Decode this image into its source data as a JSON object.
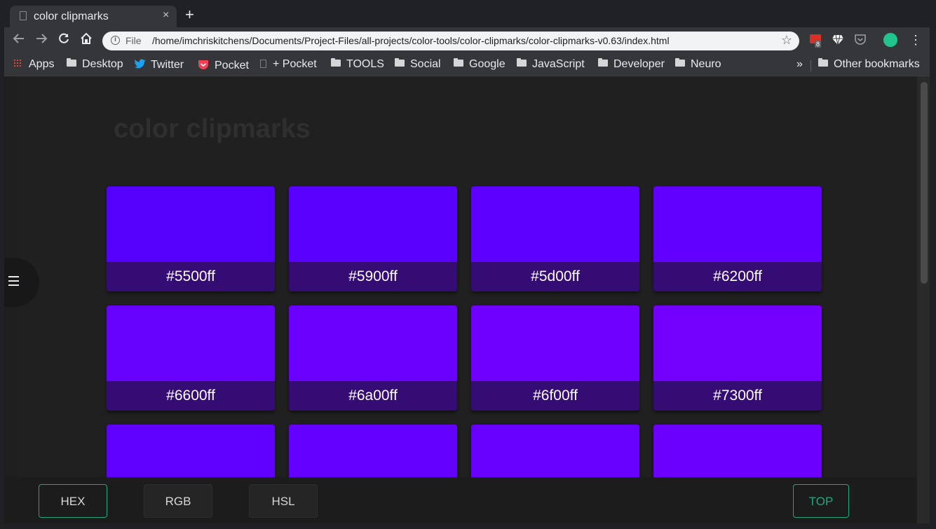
{
  "browser": {
    "tab": {
      "title": "color clipmarks",
      "close": "×"
    },
    "new_tab": "+",
    "address": {
      "scheme": "File",
      "url": "/home/imchriskitchens/Documents/Project-Files/all-projects/color-tools/color-clipmarks/color-clipmarks-v0.63/index.html"
    },
    "extension_badge": "8",
    "bookmarks": [
      {
        "label": "Apps",
        "icon": "apps-grid-icon"
      },
      {
        "label": "Desktop",
        "icon": "folder-icon"
      },
      {
        "label": "Twitter",
        "icon": "twitter-icon"
      },
      {
        "label": "Pocket",
        "icon": "pocket-icon"
      },
      {
        "label": "+ Pocket",
        "icon": "page-icon"
      },
      {
        "label": "TOOLS",
        "icon": "folder-icon"
      },
      {
        "label": "Social",
        "icon": "folder-icon"
      },
      {
        "label": "Google",
        "icon": "folder-icon"
      },
      {
        "label": "JavaScript",
        "icon": "folder-icon"
      },
      {
        "label": "Developer",
        "icon": "folder-icon"
      },
      {
        "label": "Neuro",
        "icon": "folder-icon"
      }
    ],
    "overflow": "»",
    "other_bookmarks": "Other bookmarks"
  },
  "page": {
    "title": "color clipmarks",
    "colors": [
      {
        "hex": "#5500ff",
        "label": "#5500ff"
      },
      {
        "hex": "#5900ff",
        "label": "#5900ff"
      },
      {
        "hex": "#5d00ff",
        "label": "#5d00ff"
      },
      {
        "hex": "#6200ff",
        "label": "#6200ff"
      },
      {
        "hex": "#6600ff",
        "label": "#6600ff"
      },
      {
        "hex": "#6a00ff",
        "label": "#6a00ff"
      },
      {
        "hex": "#6f00ff",
        "label": "#6f00ff"
      },
      {
        "hex": "#7300ff",
        "label": "#7300ff"
      },
      {
        "hex": "#5f00ff",
        "label": ""
      },
      {
        "hex": "#6300ff",
        "label": ""
      },
      {
        "hex": "#6700ff",
        "label": ""
      },
      {
        "hex": "#6b00ff",
        "label": ""
      }
    ],
    "footer": {
      "hex": "HEX",
      "rgb": "RGB",
      "hsl": "HSL",
      "top": "TOP"
    },
    "accent_color": "#1fa87e"
  }
}
